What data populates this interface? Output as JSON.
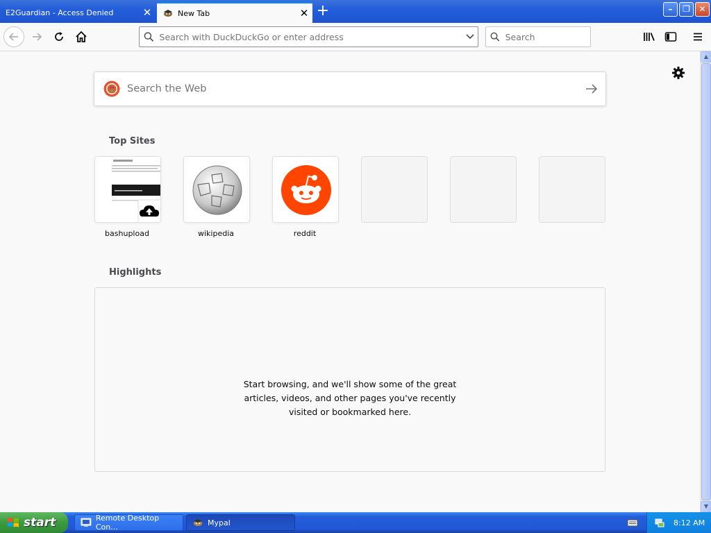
{
  "tabs": [
    {
      "label": "E2Guardian - Access Denied",
      "close": "✕"
    },
    {
      "label": "New Tab",
      "close": "✕"
    }
  ],
  "new_tab_symbol": "+",
  "window_controls": {
    "minimize": "–",
    "maximize": "❐",
    "close": "✕"
  },
  "nav": {
    "url_placeholder": "Search with DuckDuckGo or enter address",
    "search_placeholder": "Search"
  },
  "content": {
    "web_search_placeholder": "Search the Web",
    "top_sites_title": "Top Sites",
    "top_sites": [
      {
        "label": "bashupload",
        "icon": "bashupload-thumbnail"
      },
      {
        "label": "wikipedia",
        "icon": "wikipedia-globe-icon"
      },
      {
        "label": "reddit",
        "icon": "reddit-icon"
      }
    ],
    "highlights_title": "Highlights",
    "highlights_empty": "Start browsing, and we'll show some of the great articles, videos, and other pages you've recently visited or bookmarked here."
  },
  "taskbar": {
    "start_label": "start",
    "tasks": [
      {
        "label": "Remote Desktop Con..."
      },
      {
        "label": "Mypal"
      }
    ],
    "clock": "8:12 AM"
  },
  "colors": {
    "accent": "#0a84ff",
    "reddit": "#ff4500",
    "xp_blue": "#245edb",
    "xp_green": "#3c9a3e"
  }
}
